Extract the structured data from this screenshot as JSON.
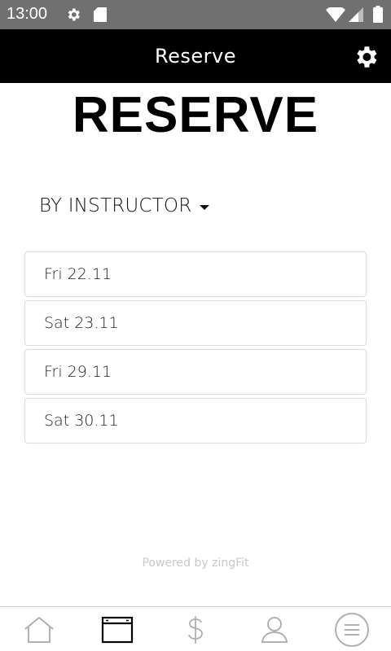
{
  "status_bar": {
    "time": "13:00"
  },
  "app_bar": {
    "title": "Reserve"
  },
  "page": {
    "heading": "RESERVE"
  },
  "filter": {
    "selected": "BY INSTRUCTOR"
  },
  "dates": [
    "Fri 22.11",
    "Sat 23.11",
    "Fri 29.11",
    "Sat 30.11"
  ],
  "footer": {
    "powered_by": "Powered by zingFit"
  },
  "bottom_nav": {
    "items": [
      {
        "icon": "home-icon",
        "active": false
      },
      {
        "icon": "calendar-icon",
        "active": true
      },
      {
        "icon": "dollar-icon",
        "active": false
      },
      {
        "icon": "profile-icon",
        "active": false
      },
      {
        "icon": "menu-icon",
        "active": false
      }
    ]
  },
  "colors": {
    "status_bar": "#707070",
    "app_bar": "#000000",
    "border": "#dcdcdc",
    "inactive_icon": "#b0b0b0",
    "active_icon": "#000000"
  }
}
